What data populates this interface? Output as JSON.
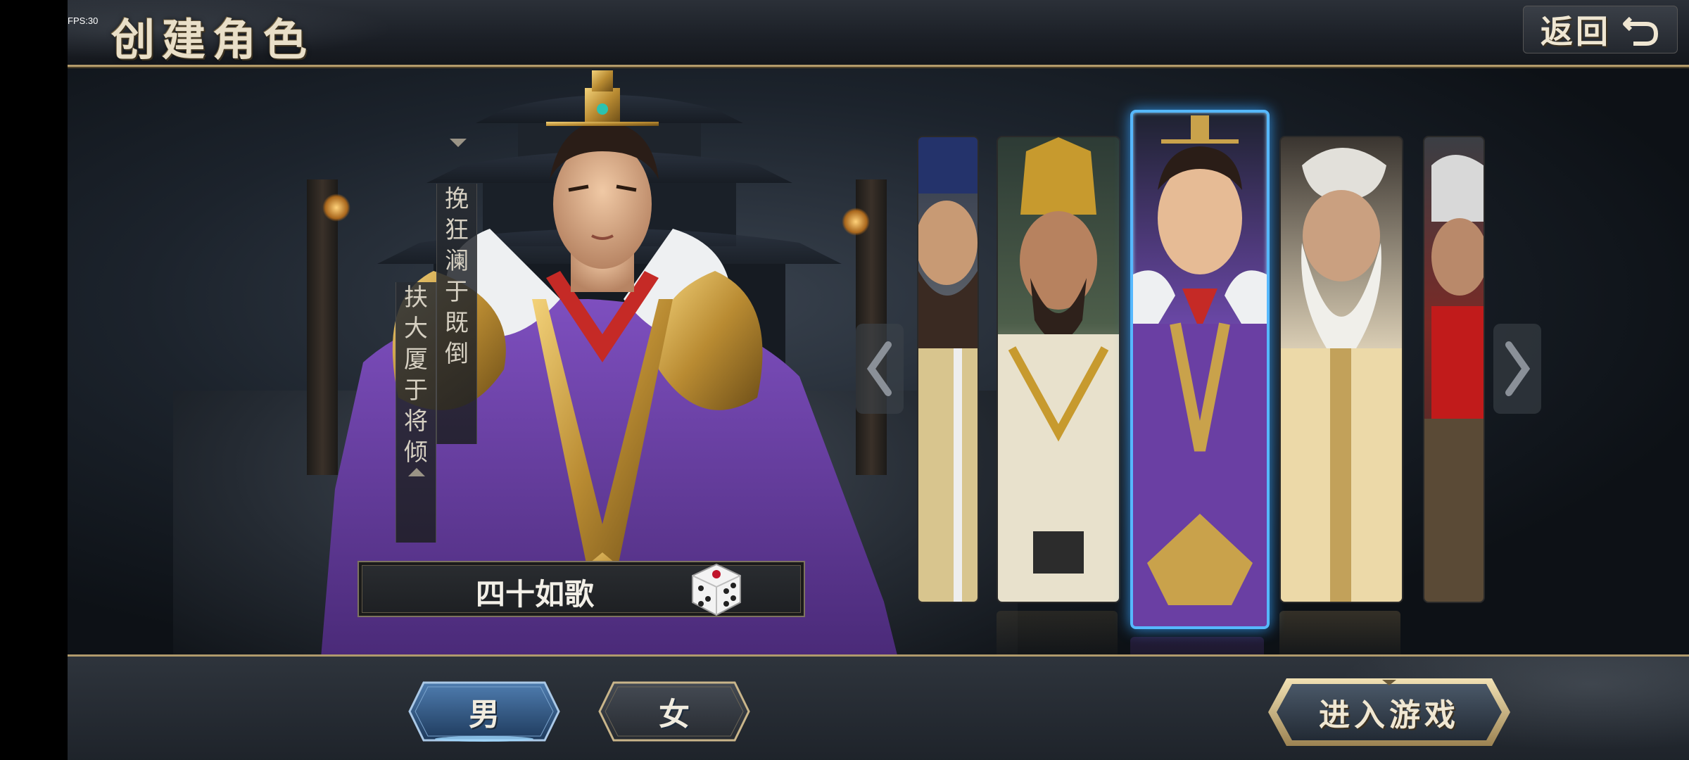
{
  "hud": {
    "fps": "FPS:30"
  },
  "header": {
    "title": "创建角色",
    "back_label": "返回"
  },
  "couplet": {
    "right_line": [
      "挽",
      "狂",
      "澜",
      "于",
      "既",
      "倒"
    ],
    "left_line": [
      "扶",
      "大",
      "厦",
      "于",
      "将",
      "倾"
    ]
  },
  "character": {
    "name": "四十如歌"
  },
  "carousel": {
    "cards": [
      "blue-hat-general",
      "bearded-minister",
      "young-lord",
      "white-haired-elder",
      "red-scarf-warrior"
    ],
    "selected_index": 2
  },
  "footer": {
    "male_label": "男",
    "female_label": "女",
    "enter_label": "进入游戏",
    "selected_gender": "男"
  },
  "colors": {
    "accent_gold": "#b39b6a",
    "selection_blue": "#56b8ff",
    "robe_purple": "#6a3fa3"
  },
  "icons": {
    "back": "return-arrow-icon",
    "dice": "dice-icon",
    "prev": "chevron-left-icon",
    "next": "chevron-right-icon"
  }
}
